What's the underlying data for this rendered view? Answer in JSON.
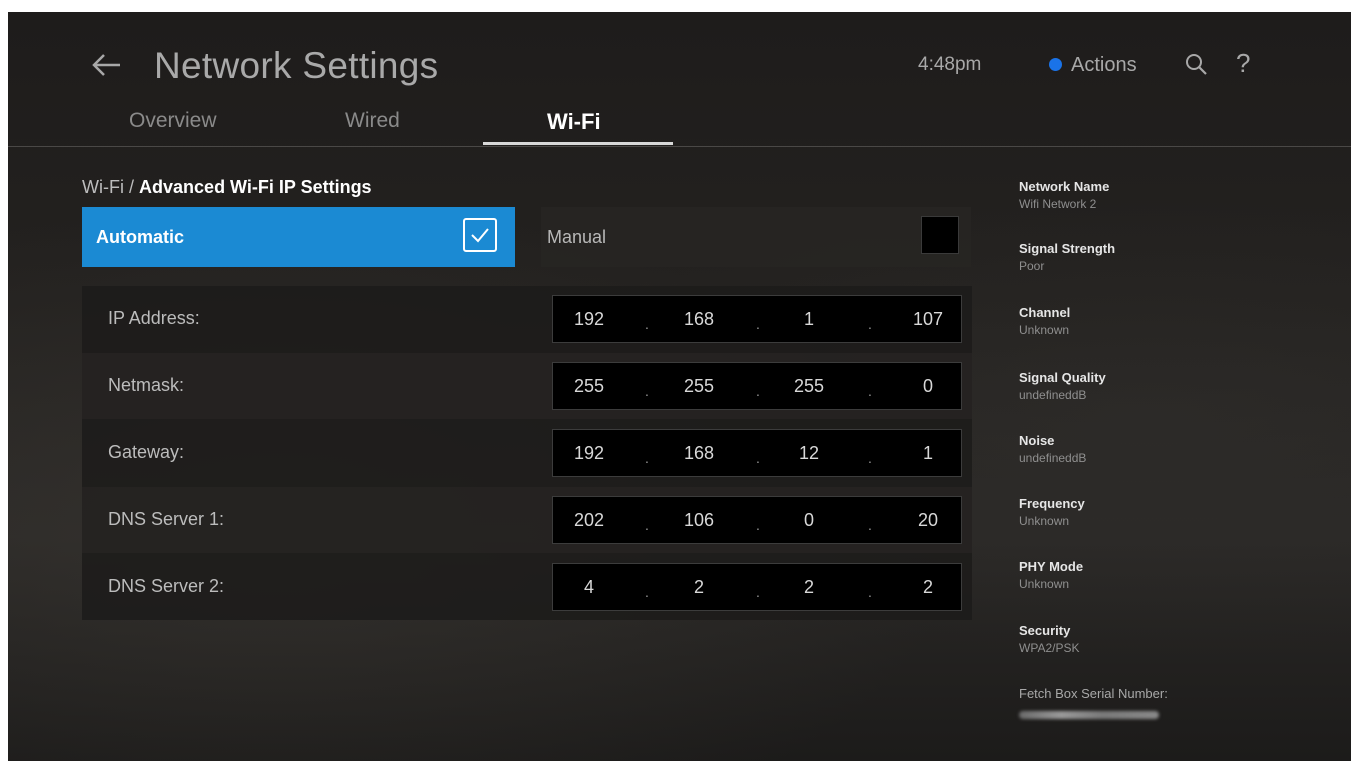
{
  "header": {
    "title": "Network Settings",
    "time": "4:48pm",
    "actions_label": "Actions",
    "accent_color": "#1a73e8"
  },
  "tabs": [
    {
      "label": "Overview",
      "active": false
    },
    {
      "label": "Wired",
      "active": false
    },
    {
      "label": "Wi-Fi",
      "active": true
    }
  ],
  "breadcrumb": {
    "parent": "Wi-Fi",
    "separator": "/",
    "current": "Advanced Wi-Fi IP Settings"
  },
  "mode": {
    "automatic_label": "Automatic",
    "automatic_checked": true,
    "manual_label": "Manual",
    "manual_checked": false,
    "selected_color": "#1b8ad3"
  },
  "fields": [
    {
      "label": "IP Address:",
      "octets": [
        "192",
        "168",
        "1",
        "107"
      ]
    },
    {
      "label": "Netmask:",
      "octets": [
        "255",
        "255",
        "255",
        "0"
      ]
    },
    {
      "label": "Gateway:",
      "octets": [
        "192",
        "168",
        "12",
        "1"
      ]
    },
    {
      "label": "DNS Server 1:",
      "octets": [
        "202",
        "106",
        "0",
        "20"
      ]
    },
    {
      "label": "DNS Server 2:",
      "octets": [
        "4",
        "2",
        "2",
        "2"
      ]
    }
  ],
  "info": [
    {
      "label": "Network Name",
      "value": "Wifi Network 2"
    },
    {
      "label": "Signal Strength",
      "value": "Poor"
    },
    {
      "label": "Channel",
      "value": "Unknown"
    },
    {
      "label": "Signal Quality",
      "value": "undefineddB"
    },
    {
      "label": "Noise",
      "value": "undefineddB"
    },
    {
      "label": "Frequency",
      "value": "Unknown"
    },
    {
      "label": "PHY Mode",
      "value": "Unknown"
    },
    {
      "label": "Security",
      "value": "WPA2/PSK"
    }
  ],
  "serial": {
    "label": "Fetch Box Serial Number:"
  },
  "icons": {
    "back": "back-arrow-icon",
    "search": "search-icon",
    "help": "help-icon",
    "check": "checkmark-icon"
  }
}
